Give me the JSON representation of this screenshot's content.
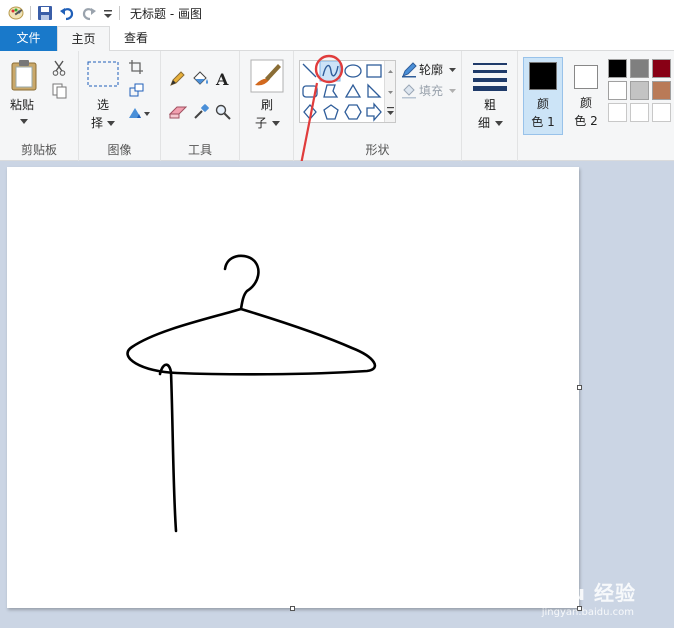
{
  "window": {
    "title": "无标题 - 画图"
  },
  "tabs": {
    "file": "文件",
    "home": "主页",
    "view": "查看"
  },
  "groups": {
    "clipboard": {
      "label": "剪贴板",
      "paste": "粘贴"
    },
    "image": {
      "label": "图像",
      "select_line1": "选",
      "select_line2": "择"
    },
    "tools": {
      "label": "工具"
    },
    "brushes": {
      "line1": "刷",
      "line2": "子"
    },
    "shapes": {
      "label": "形状",
      "outline": "轮廓",
      "fill": "填充"
    },
    "size": {
      "line1": "粗",
      "line2": "细"
    },
    "colors": {
      "color1_line1": "颜",
      "color1_line2": "色 1",
      "color2_line1": "颜",
      "color2_line2": "色 2",
      "color1": "#000000",
      "color2": "#ffffff",
      "palette": [
        "#000000",
        "#7f7f7f",
        "#880015",
        "#ffffff",
        "#c3c3c3",
        "#b97a57",
        "",
        "",
        ""
      ]
    }
  },
  "annotation": {
    "color": "#e03c3c"
  },
  "watermark": {
    "main": "Bai du 经验",
    "sub": "jingyan.baidu.com"
  }
}
